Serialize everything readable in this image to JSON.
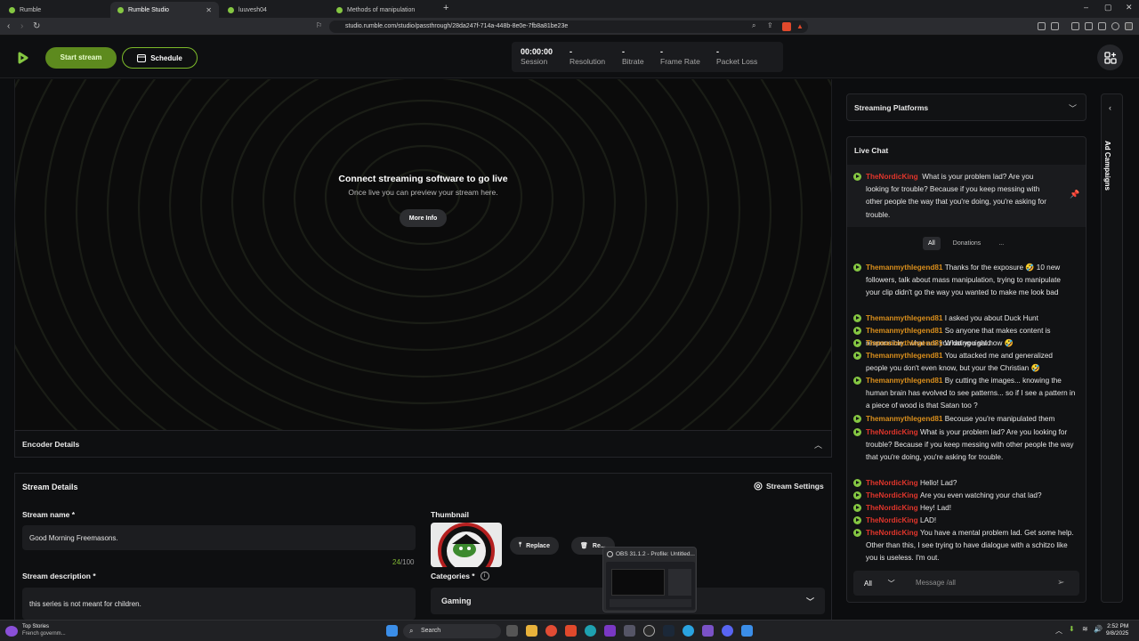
{
  "browser": {
    "tabs": [
      {
        "label": "Rumble",
        "active": false
      },
      {
        "label": "Rumble Studio",
        "active": true
      },
      {
        "label": "luuvesh04",
        "active": false
      },
      {
        "label": "Methods of manipulation",
        "active": false
      }
    ],
    "url": "studio.rumble.com/studio/passthrough/28da247f-714a-448b-8e0e-7fb8a81be23e"
  },
  "header": {
    "start_stream": "Start stream",
    "schedule": "Schedule",
    "stats": [
      {
        "value": "00:00:00",
        "label": "Session"
      },
      {
        "value": "-",
        "label": "Resolution"
      },
      {
        "value": "-",
        "label": "Bitrate"
      },
      {
        "value": "-",
        "label": "Frame Rate"
      },
      {
        "value": "-",
        "label": "Packet Loss"
      }
    ]
  },
  "preview": {
    "title": "Connect streaming software to go live",
    "subtitle": "Once live you can preview your stream here.",
    "more_info": "More Info"
  },
  "encoder": {
    "title": "Encoder Details"
  },
  "details": {
    "title": "Stream Details",
    "settings": "Stream Settings",
    "name_label": "Stream name *",
    "name_value": "Good Morning Freemasons.",
    "name_count": "24",
    "name_max": "/100",
    "description_label": "Stream description *",
    "description_value": "this series is not meant for children.",
    "thumbnail_label": "Thumbnail",
    "replace": "Replace",
    "remove": "Re...",
    "categories_label": "Categories *",
    "category_value": "Gaming"
  },
  "obs_popup": {
    "title": "OBS 31.1.2 - Profile: Untitled..."
  },
  "right": {
    "platforms_title": "Streaming Platforms",
    "chat_title": "Live Chat",
    "ad_campaigns": "Ad Campaigns",
    "pinned": {
      "user": "TheNordicKing",
      "text": "What is your problem lad? Are you looking for trouble? Because if you keep messing with other people the way that you're doing, you're asking for trouble."
    },
    "filters": [
      "All",
      "Donations",
      "..."
    ],
    "messages": [
      {
        "user": "Themanmythlegend81",
        "text": "Thanks for the exposure 🤣 10 new followers, talk about mass manipulation, trying to manipulate your clip didn't go the way you wanted to make me look bad"
      },
      {
        "user": "Themanmythlegend81",
        "text": "I asked you about Duck Hunt"
      },
      {
        "user": "Themanmythlegend81",
        "text": "So anyone that makes content is responsible...what are you doing right now 🤣"
      },
      {
        "user": "Themanmythlegend81",
        "text": "What you said"
      },
      {
        "user": "Themanmythlegend81",
        "text": "You attacked me and generalized people you don't even know, but your the Christian 🤣"
      },
      {
        "user": "Themanmythlegend81",
        "text": "By cutting the images... knowing the human brain has evolved to see patterns... so if I see a pattern in a piece of wood is that Satan too ?"
      },
      {
        "user": "Themanmythlegend81",
        "text": "Becouse you're manipulated them"
      },
      {
        "user": "TheNordicKing",
        "text": "What is your problem lad? Are you looking for trouble? Because if you keep messing with other people the way that you're doing, you're asking for trouble."
      },
      {
        "user": "TheNordicKing",
        "text": "Hello! Lad?"
      },
      {
        "user": "TheNordicKing",
        "text": "Are you even watching your chat lad?"
      },
      {
        "user": "TheNordicKing",
        "text": "Hey! Lad!"
      },
      {
        "user": "TheNordicKing",
        "text": "LAD!"
      },
      {
        "user": "TheNordicKing",
        "text": "You have a mental problem lad. Get some help. Other than this, I see trying to have dialogue with a schitzo like you is useless. I'm out."
      }
    ],
    "chat_select": "All",
    "chat_placeholder": "Message /all"
  },
  "taskbar": {
    "news_title": "Top Stories",
    "news_sub": "French governm...",
    "search": "Search",
    "time": "2:52 PM",
    "date": "9/8/2025"
  },
  "colors": {
    "accent": "#85c742",
    "user_a": "#d98e1c",
    "user_b": "#e0352b"
  }
}
